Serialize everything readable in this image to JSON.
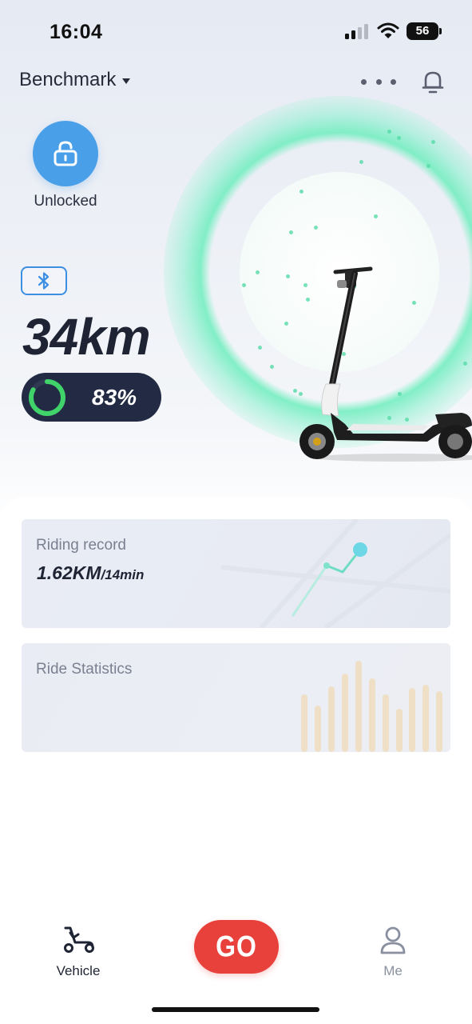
{
  "status_bar": {
    "time": "16:04",
    "battery_level": "56",
    "signal_icon": "cellular-signal-icon",
    "wifi_icon": "wifi-icon"
  },
  "header": {
    "device_name": "Benchmark",
    "device_dropdown_icon": "caret-down-icon",
    "more_icon": "more-dots-icon",
    "notification_icon": "bell-icon"
  },
  "vehicle": {
    "lock_status": "Unlocked",
    "lock_icon": "unlocked-padlock-icon",
    "bluetooth_icon": "bluetooth-icon",
    "range": "34km",
    "battery_percent_label": "83%",
    "battery_fraction": 0.83
  },
  "cards": {
    "riding_record": {
      "title": "Riding record",
      "distance": "1.62KM",
      "duration": "/14min"
    },
    "ride_statistics": {
      "title": "Ride Statistics"
    }
  },
  "bottom_nav": {
    "vehicle_label": "Vehicle",
    "go_label": "GO",
    "me_label": "Me"
  },
  "colors": {
    "accent_blue": "#4a9fe9",
    "go_red": "#e8403b",
    "battery_green": "#3fd36a",
    "pill_navy": "#232b44",
    "halo_mint": "#6eeebe"
  }
}
